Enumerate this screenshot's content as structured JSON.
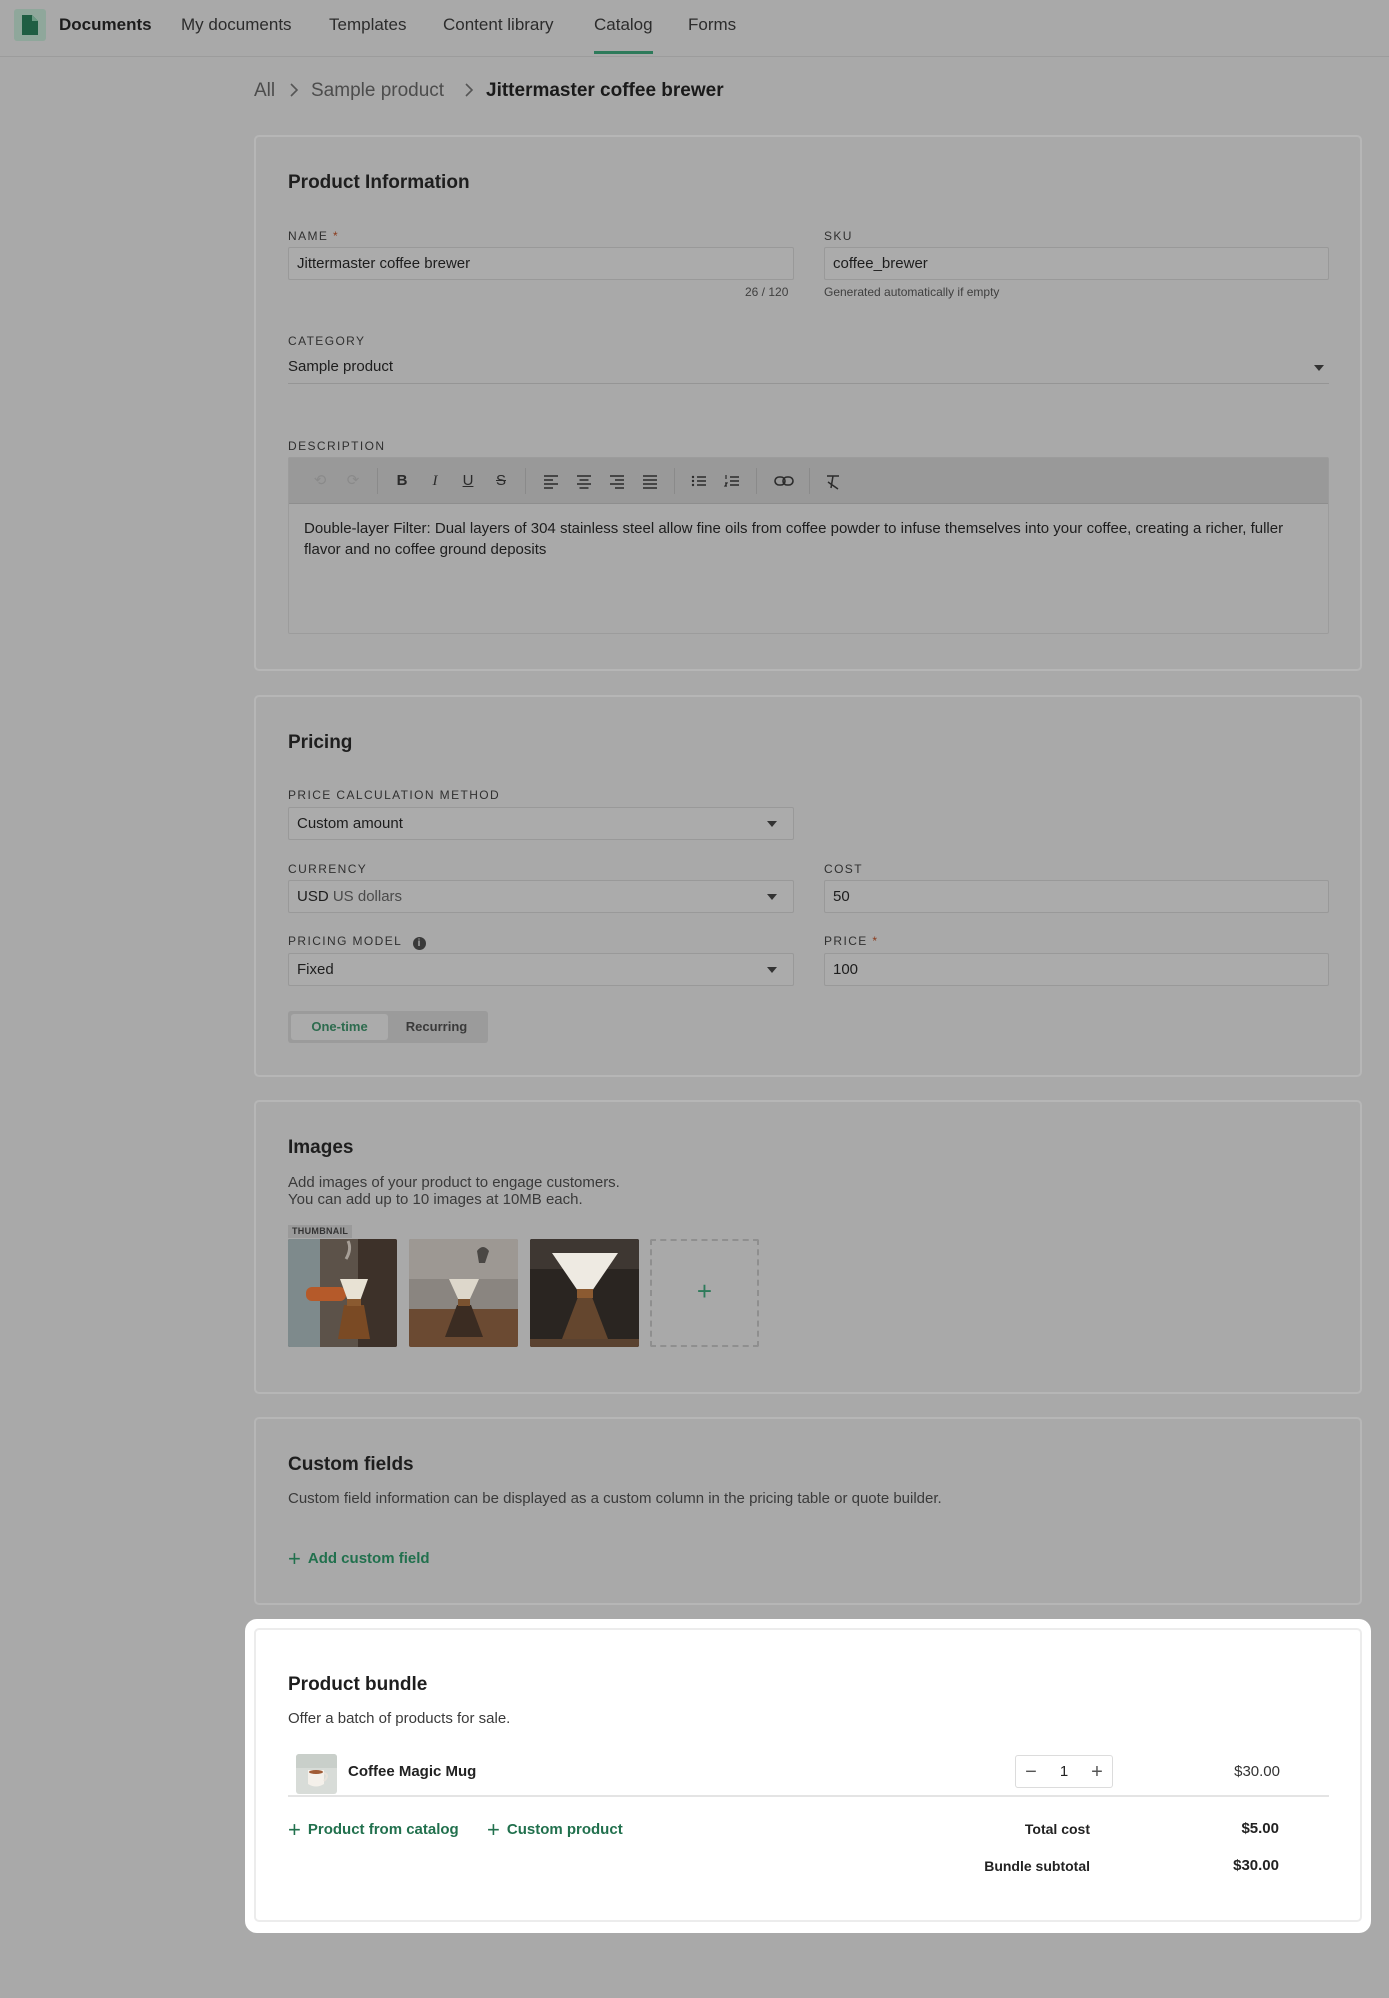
{
  "app": {
    "brand": "Documents"
  },
  "nav": [
    {
      "label": "My documents",
      "active": false
    },
    {
      "label": "Templates",
      "active": false
    },
    {
      "label": "Content library",
      "active": false
    },
    {
      "label": "Catalog",
      "active": true
    },
    {
      "label": "Forms",
      "active": false
    }
  ],
  "breadcrumb": {
    "root": "All",
    "parent": "Sample product",
    "current": "Jittermaster coffee brewer"
  },
  "product_info": {
    "title": "Product Information",
    "name_label": "NAME",
    "name_required": "*",
    "name_value": "Jittermaster coffee brewer",
    "name_counter": "26 / 120",
    "sku_label": "SKU",
    "sku_value": "coffee_brewer",
    "sku_hint": "Generated automatically if empty",
    "category_label": "CATEGORY",
    "category_value": "Sample product",
    "description_label": "DESCRIPTION",
    "description_text": "Double-layer Filter: Dual layers of 304 stainless steel allow fine oils from coffee powder to infuse themselves into your coffee, creating a richer, fuller flavor and no coffee ground deposits"
  },
  "pricing": {
    "title": "Pricing",
    "method_label": "PRICE CALCULATION METHOD",
    "method_value": "Custom amount",
    "currency_label": "CURRENCY",
    "currency_code": "USD",
    "currency_name": "US dollars",
    "cost_label": "COST",
    "cost_value": "50",
    "model_label": "PRICING MODEL",
    "model_value": "Fixed",
    "price_label": "PRICE",
    "price_required": "*",
    "price_value": "100",
    "toggle_one_time": "One-time",
    "toggle_recurring": "Recurring",
    "toggle_selected": "One-time"
  },
  "images": {
    "title": "Images",
    "line1": "Add images of your product to engage customers.",
    "line2": "You can add up to 10 images at 10MB each.",
    "thumbnail_badge": "THUMBNAIL",
    "add_symbol": "+"
  },
  "custom_fields": {
    "title": "Custom fields",
    "description": "Custom field information can be displayed as a custom column in the pricing table or quote builder.",
    "add_label": "Add custom field"
  },
  "bundle": {
    "title": "Product bundle",
    "description": "Offer a batch of products for sale.",
    "items": [
      {
        "name": "Coffee Magic Mug",
        "quantity": "1",
        "price": "$30.00"
      }
    ],
    "add_from_catalog": "Product from catalog",
    "add_custom": "Custom product",
    "total_cost_label": "Total cost",
    "total_cost_value": "$5.00",
    "subtotal_label": "Bundle subtotal",
    "subtotal_value": "$30.00"
  },
  "colors": {
    "accent": "#21704d",
    "overlay": "#a9a9a9",
    "highlight": "#ffffff"
  }
}
